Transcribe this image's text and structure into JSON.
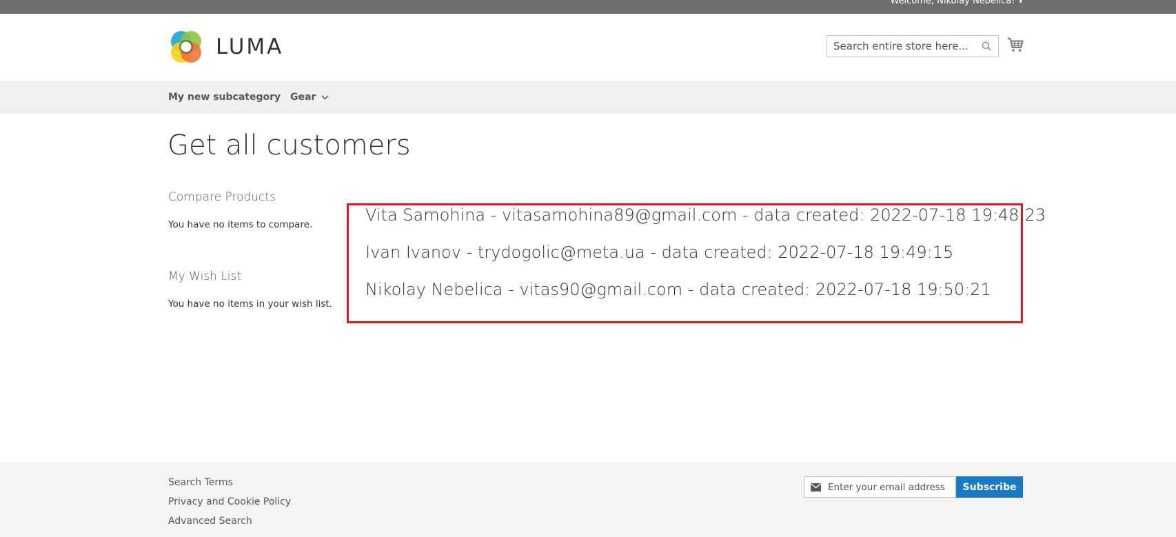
{
  "topbar": {
    "welcome": "Welcome, Nikolay Nebelica!"
  },
  "header": {
    "logo_text": "LUMA",
    "search_placeholder": "Search entire store here...",
    "icons": {
      "search": "search-icon",
      "cart": "cart-icon"
    }
  },
  "nav": {
    "items": [
      {
        "label": "My new subcategory"
      },
      {
        "label": "Gear"
      }
    ]
  },
  "main": {
    "title": "Get all customers",
    "customers": [
      "Vita Samohina - vitasamohina89@gmail.com - data created: 2022-07-18 19:48:23",
      "Ivan Ivanov - trydogolic@meta.ua - data created: 2022-07-18 19:49:15",
      "Nikolay Nebelica - vitas90@gmail.com - data created: 2022-07-18 19:50:21"
    ],
    "highlight_color": "#e3151e"
  },
  "sidebar": {
    "compare": {
      "title": "Compare Products",
      "empty": "You have no items to compare."
    },
    "wishlist": {
      "title": "My Wish List",
      "empty": "You have no items in your wish list."
    }
  },
  "footer": {
    "links": [
      "Search Terms",
      "Privacy and Cookie Policy",
      "Advanced Search"
    ],
    "newsletter": {
      "placeholder": "Enter your email address",
      "button": "Subscribe"
    },
    "accent_color": "#1979c3"
  }
}
